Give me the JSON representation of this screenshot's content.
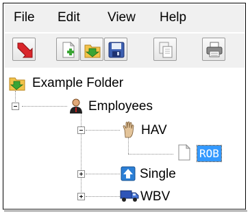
{
  "menu": {
    "file": "File",
    "edit": "Edit",
    "view": "View",
    "help": "Help"
  },
  "toolbar": {
    "buttons": [
      {
        "icon": "red-down-arrow-icon",
        "color": "#d9262b"
      },
      {
        "icon": "new-document-icon",
        "color": "#3aa535"
      },
      {
        "icon": "open-folder-icon",
        "color": "#e8b13a"
      },
      {
        "icon": "save-disk-icon",
        "color": "#3c5fb0"
      },
      {
        "icon": "copy-document-icon",
        "color": "#8a8a8a"
      },
      {
        "icon": "printer-icon",
        "color": "#707070"
      }
    ]
  },
  "tree": {
    "root": "Example Folder",
    "employees": "Employees",
    "hav": "HAV",
    "rob": "ROB",
    "single": "Single",
    "wbv": "WBV"
  },
  "colors": {
    "selection": "#3399ff",
    "chrome": "#f0f0f0"
  }
}
